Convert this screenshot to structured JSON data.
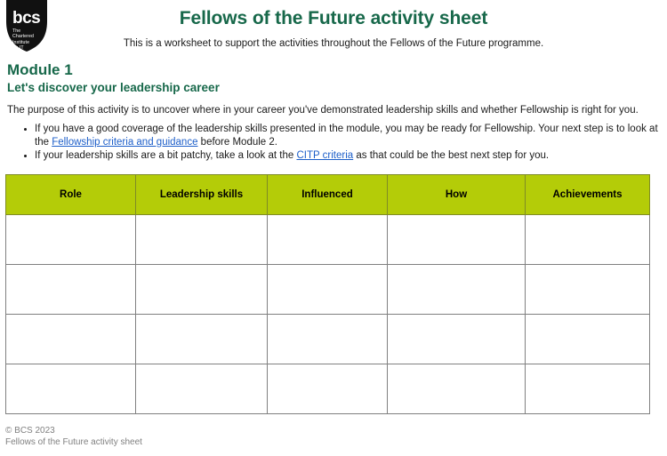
{
  "logo": {
    "wordmark": "bcs",
    "strapline": "The\nChartered\nInstitute\nfor IT",
    "strap_line_1": "The",
    "strap_line_2": "Chartered",
    "strap_line_3": "Institute",
    "strap_line_4": "for IT"
  },
  "header": {
    "title": "Fellows of the Future activity sheet",
    "subtitle": "This is a worksheet to support the activities throughout the Fellows of the Future programme."
  },
  "module": {
    "title": "Module 1",
    "subtitle": "Let's discover your leadership career",
    "intro": "The purpose of this activity is to uncover where in your career you've demonstrated leadership skills and whether Fellowship is right for you.",
    "bullets": [
      {
        "before": "If you have a good coverage of the leadership skills presented in the module, you may be ready for Fellowship. Your next step is to look at the ",
        "link": "Fellowship criteria and guidance",
        "after": " before Module 2."
      },
      {
        "before": "If your leadership skills are a bit patchy, take a look at the ",
        "link": "CITP criteria",
        "after": " as that could be the best next step for you."
      }
    ]
  },
  "table": {
    "headers": [
      "Role",
      "Leadership skills",
      "Influenced",
      "How",
      "Achievements"
    ],
    "rows": [
      [
        "",
        "",
        "",
        "",
        ""
      ],
      [
        "",
        "",
        "",
        "",
        ""
      ],
      [
        "",
        "",
        "",
        "",
        ""
      ],
      [
        "",
        "",
        "",
        "",
        ""
      ]
    ]
  },
  "footer": {
    "copyright": "© BCS 2023",
    "document_name": "Fellows of the Future activity sheet"
  },
  "colors": {
    "brand_green": "#17684a",
    "table_header": "#b4cc08",
    "link_blue": "#1c5ec9",
    "footer_gray": "#808080"
  }
}
